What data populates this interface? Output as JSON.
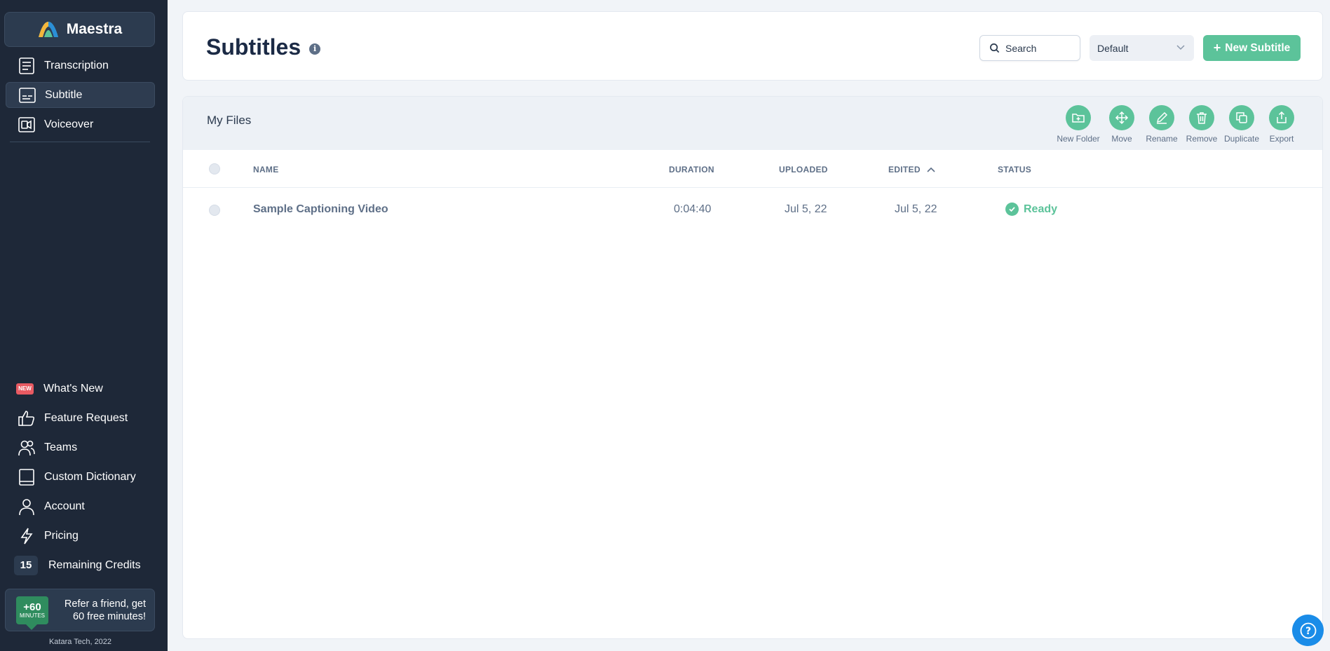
{
  "app": {
    "name": "Maestra"
  },
  "sidebar": {
    "nav": [
      {
        "label": "Transcription",
        "icon": "transcription-icon"
      },
      {
        "label": "Subtitle",
        "icon": "subtitle-icon",
        "active": true
      },
      {
        "label": "Voiceover",
        "icon": "voiceover-icon"
      }
    ],
    "bottom": {
      "whats_new": {
        "label": "What's New",
        "badge": "NEW"
      },
      "feature_request": "Feature Request",
      "teams": "Teams",
      "custom_dictionary": "Custom Dictionary",
      "account": "Account",
      "pricing": "Pricing",
      "credits": {
        "count": "15",
        "label": "Remaining Credits"
      }
    },
    "refer": {
      "badge_big": "+60",
      "badge_small": "MINUTES",
      "line1": "Refer a friend, get",
      "line2": "60 free minutes!"
    },
    "footer": "Katara Tech, 2022"
  },
  "header": {
    "title": "Subtitles",
    "info_glyph": "i",
    "search_placeholder": "Search",
    "select_value": "Default",
    "new_button": "New Subtitle",
    "new_button_plus": "+"
  },
  "files": {
    "title": "My Files",
    "actions": [
      {
        "label": "New Folder",
        "icon": "new-folder-icon"
      },
      {
        "label": "Move",
        "icon": "move-icon"
      },
      {
        "label": "Rename",
        "icon": "rename-icon"
      },
      {
        "label": "Remove",
        "icon": "trash-icon"
      },
      {
        "label": "Duplicate",
        "icon": "duplicate-icon"
      },
      {
        "label": "Export",
        "icon": "export-icon"
      }
    ],
    "columns": {
      "name": "NAME",
      "duration": "DURATION",
      "uploaded": "UPLOADED",
      "edited": "EDITED",
      "status": "STATUS"
    },
    "sort": {
      "column": "edited",
      "direction": "ascending"
    },
    "rows": [
      {
        "name": "Sample Captioning Video",
        "duration": "0:04:40",
        "uploaded": "Jul 5, 22",
        "edited": "Jul 5, 22",
        "status": "Ready"
      }
    ]
  },
  "colors": {
    "sidebar_bg": "#1e2838",
    "accent_green": "#5cc39a",
    "help_blue": "#1a8ce8",
    "new_badge": "#e85a62"
  },
  "help": {
    "glyph": "?"
  }
}
